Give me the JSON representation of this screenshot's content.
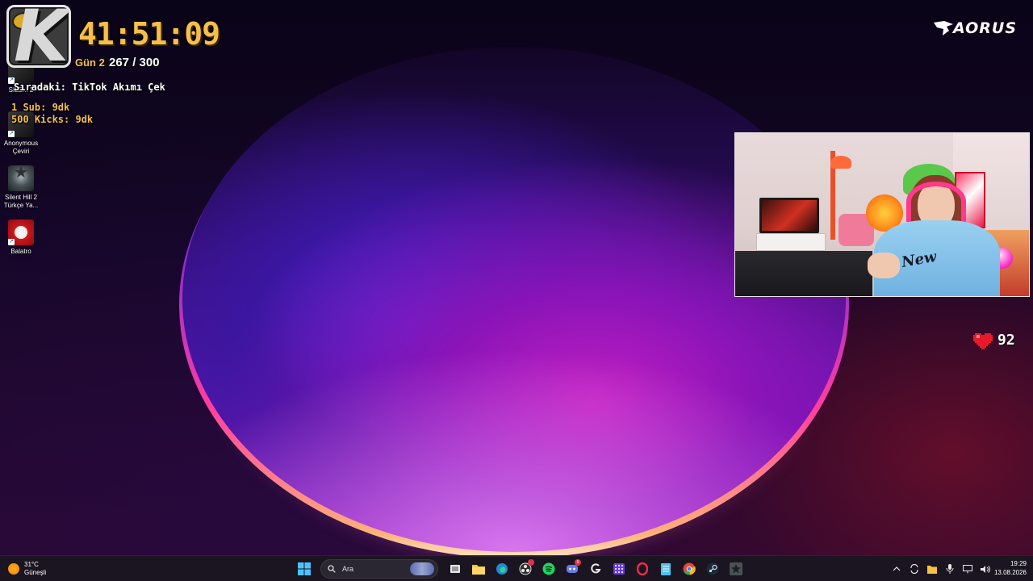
{
  "overlay": {
    "timer": "41:51:09",
    "day": "Gün 2",
    "count": "267 / 300",
    "next": "Sıradaki: TikTok Akımı Çek",
    "sub": "1 Sub: 9dk",
    "kicks": "500 Kicks: 9dk",
    "brand": "AORUS",
    "hearts": "92"
  },
  "desktop": {
    "icons": [
      {
        "label": "SILE... 2",
        "icon": "silent-hill-2-icon"
      },
      {
        "label": "Anonymous Çeviri",
        "icon": "anonymous-translation-icon"
      },
      {
        "label": "Silent Hill 2 Türkçe Ya...",
        "icon": "silent-hill-2-turkish-icon"
      },
      {
        "label": "Balatro",
        "icon": "balatro-icon"
      }
    ]
  },
  "taskbar": {
    "weather_temp": "31°C",
    "weather_desc": "Güneşli",
    "search_placeholder": "Ara",
    "apps": [
      "windows-start-icon",
      "task-view-icon",
      "file-explorer-icon",
      "edge-icon",
      "obs-icon",
      "spotify-icon",
      "discord-icon",
      "logitech-g-icon",
      "calculator-icon",
      "opera-gx-icon",
      "notepad-icon",
      "chrome-icon",
      "steam-icon",
      "game-icon"
    ],
    "discord_badge": "5",
    "time": "19:29",
    "date": "13.08.2026"
  },
  "colors": {
    "accent_gold": "#f5c04a",
    "taskbar_bg": "#1c1622"
  }
}
